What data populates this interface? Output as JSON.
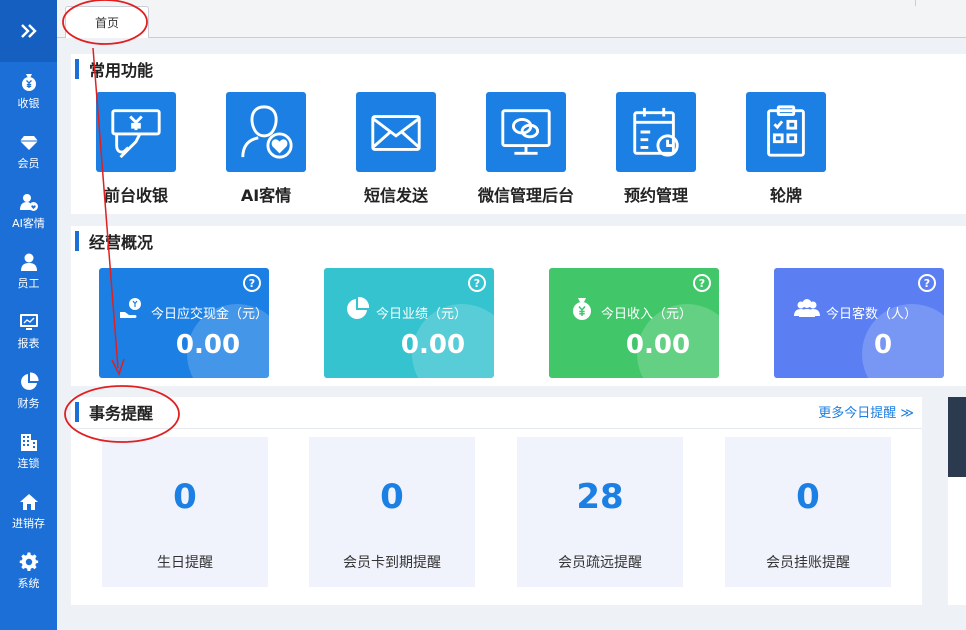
{
  "sidebar": {
    "toggle_icon": "double-chevron-right-icon",
    "items": [
      {
        "label": "收银",
        "icon": "yen-bag-icon"
      },
      {
        "label": "会员",
        "icon": "diamond-icon"
      },
      {
        "label": "AI客情",
        "icon": "user-heart-icon"
      },
      {
        "label": "员工",
        "icon": "user-icon"
      },
      {
        "label": "报表",
        "icon": "monitor-chart-icon"
      },
      {
        "label": "财务",
        "icon": "pie-chart-icon"
      },
      {
        "label": "连锁",
        "icon": "building-icon"
      },
      {
        "label": "进销存",
        "icon": "house-icon"
      },
      {
        "label": "系统",
        "icon": "gear-icon"
      }
    ]
  },
  "tabs": [
    {
      "label": "首页"
    }
  ],
  "quick": {
    "title": "常用功能",
    "items": [
      {
        "label": "前台收银",
        "icon": "cashier-icon"
      },
      {
        "label": "AI客情",
        "icon": "ai-customer-icon"
      },
      {
        "label": "短信发送",
        "icon": "envelope-icon"
      },
      {
        "label": "微信管理后台",
        "icon": "wechat-monitor-icon"
      },
      {
        "label": "预约管理",
        "icon": "calendar-clock-icon"
      },
      {
        "label": "轮牌",
        "icon": "clipboard-grid-icon"
      }
    ]
  },
  "overview": {
    "title": "经营概况",
    "cards": [
      {
        "label": "今日应交现金（元）",
        "value": "0.00",
        "color": "#1c7fe3",
        "icon": "cash-hand-icon",
        "help": "?"
      },
      {
        "label": "今日业绩（元）",
        "value": "0.00",
        "color": "#34c3cf",
        "icon": "pie-icon",
        "help": "?"
      },
      {
        "label": "今日收入（元）",
        "value": "0.00",
        "color": "#41c66a",
        "icon": "money-bag-icon",
        "help": "?"
      },
      {
        "label": "今日客数（人）",
        "value": "0",
        "color": "#5b7ff2",
        "icon": "users-icon",
        "help": "?"
      }
    ]
  },
  "reminders": {
    "title": "事务提醒",
    "more_link": "更多今日提醒 ≫",
    "items": [
      {
        "value": "0",
        "label": "生日提醒"
      },
      {
        "value": "0",
        "label": "会员卡到期提醒"
      },
      {
        "value": "28",
        "label": "会员疏远提醒"
      },
      {
        "value": "0",
        "label": "会员挂账提醒"
      }
    ]
  },
  "colors": {
    "primary": "#1c6fd6",
    "annotation": "#e02020"
  }
}
